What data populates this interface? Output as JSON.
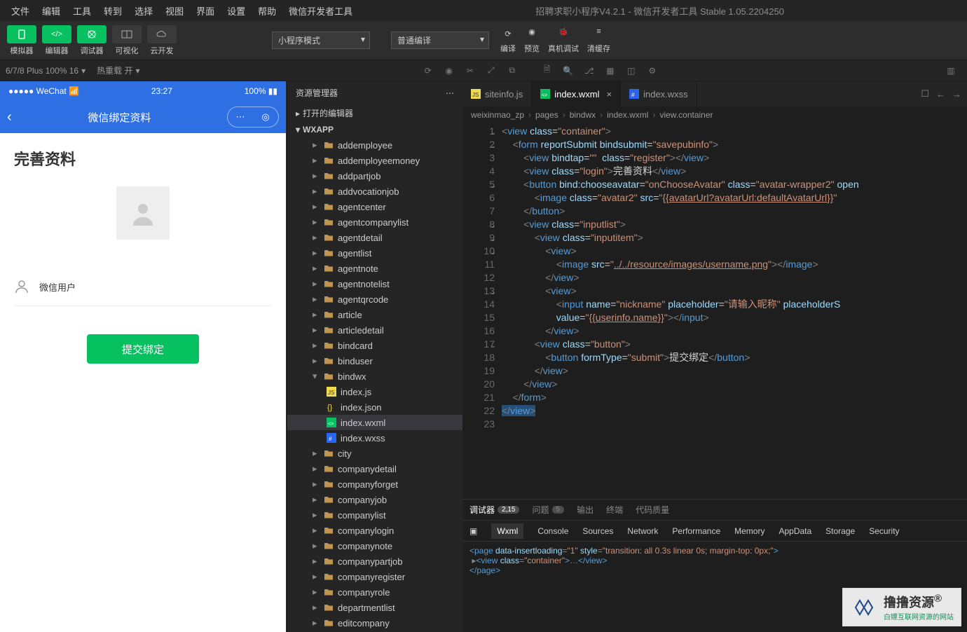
{
  "window": {
    "title": "招聘求职小程序V4.2.1 - 微信开发者工具 Stable 1.05.2204250"
  },
  "menubar": [
    "文件",
    "编辑",
    "工具",
    "转到",
    "选择",
    "视图",
    "界面",
    "设置",
    "帮助",
    "微信开发者工具"
  ],
  "toolbar": {
    "simulator": "模拟器",
    "editor": "编辑器",
    "debugger": "调试器",
    "visualize": "可视化",
    "cloud": "云开发",
    "mode_select": "小程序模式",
    "compile_select": "普通编译",
    "compile": "编译",
    "preview": "预览",
    "realdevice": "真机调试",
    "clearcache": "清缓存"
  },
  "topstrip": {
    "device": "6/7/8 Plus 100% 16",
    "hotreload": "热重载 开"
  },
  "phone": {
    "carrier": "WeChat",
    "time": "23:27",
    "battery": "100%",
    "nav_title": "微信绑定资料",
    "heading": "完善资料",
    "username": "微信用户",
    "submit": "提交绑定"
  },
  "explorer": {
    "title": "资源管理器",
    "open_editors": "打开的编辑器",
    "root": "WXAPP",
    "folders": [
      "addemployee",
      "addemployeemoney",
      "addpartjob",
      "addvocationjob",
      "agentcenter",
      "agentcompanylist",
      "agentdetail",
      "agentlist",
      "agentnote",
      "agentnotelist",
      "agentqrcode",
      "article",
      "articledetail",
      "bindcard",
      "binduser",
      "bindwx",
      "city",
      "companydetail",
      "companyforget",
      "companyjob",
      "companylist",
      "companylogin",
      "companynote",
      "companypartjob",
      "companyregister",
      "companyrole",
      "departmentlist",
      "editcompany"
    ],
    "bindwx_files": [
      "index.js",
      "index.json",
      "index.wxml",
      "index.wxss"
    ]
  },
  "tabs": [
    {
      "name": "siteinfo.js",
      "icon": "js",
      "active": false
    },
    {
      "name": "index.wxml",
      "icon": "wxml",
      "active": true
    },
    {
      "name": "index.wxss",
      "icon": "wxss",
      "active": false
    }
  ],
  "breadcrumb": [
    "weixinmao_zp",
    "pages",
    "bindwx",
    "index.wxml",
    "view.container"
  ],
  "code": {
    "lines": [
      {
        "n": 1,
        "fold": "v",
        "html": "<span class='t-brace'>&lt;</span><span class='t-tag'>view</span> <span class='t-attr'>class</span>=<span class='t-str'>\"container\"</span><span class='t-brace'>&gt;</span>"
      },
      {
        "n": 2,
        "fold": "v",
        "html": "    <span class='t-brace'>&lt;</span><span class='t-tag'>form</span> <span class='t-attr'>reportSubmit</span> <span class='t-attr'>bindsubmit</span>=<span class='t-str'>\"savepubinfo\"</span><span class='t-brace'>&gt;</span>"
      },
      {
        "n": 3,
        "html": "        <span class='t-brace'>&lt;</span><span class='t-tag'>view</span> <span class='t-attr'>bindtap</span>=<span class='t-str'>\"\"</span>  <span class='t-attr'>class</span>=<span class='t-str'>\"register\"</span><span class='t-brace'>&gt;&lt;/</span><span class='t-tag'>view</span><span class='t-brace'>&gt;</span>"
      },
      {
        "n": 4,
        "html": "        <span class='t-brace'>&lt;</span><span class='t-tag'>view</span> <span class='t-attr'>class</span>=<span class='t-str'>\"login\"</span><span class='t-brace'>&gt;</span><span class='t-txt'>完善资料</span><span class='t-brace'>&lt;/</span><span class='t-tag'>view</span><span class='t-brace'>&gt;</span>"
      },
      {
        "n": 5,
        "fold": "v",
        "html": "        <span class='t-brace'>&lt;</span><span class='t-tag'>button</span> <span class='t-attr'>bind:chooseavatar</span>=<span class='t-str'>\"onChooseAvatar\"</span> <span class='t-attr'>class</span>=<span class='t-str'>\"avatar-wrapper2\"</span> <span class='t-attr'>open</span>"
      },
      {
        "n": 6,
        "html": "            <span class='t-brace'>&lt;</span><span class='t-tag'>image</span> <span class='t-attr'>class</span>=<span class='t-str'>\"avatar2\"</span> <span class='t-attr'>src</span>=<span class='t-str'>\"<span class='t-url'>{{avatarUrl?avatarUrl:defaultAvatarUrl}}</span>\"</span>"
      },
      {
        "n": 7,
        "html": "        <span class='t-brace'>&lt;/</span><span class='t-tag'>button</span><span class='t-brace'>&gt;</span>"
      },
      {
        "n": 8,
        "fold": "v",
        "html": "        <span class='t-brace'>&lt;</span><span class='t-tag'>view</span> <span class='t-attr'>class</span>=<span class='t-str'>\"inputlist\"</span><span class='t-brace'>&gt;</span>"
      },
      {
        "n": 9,
        "fold": "v",
        "html": "            <span class='t-brace'>&lt;</span><span class='t-tag'>view</span> <span class='t-attr'>class</span>=<span class='t-str'>\"inputitem\"</span><span class='t-brace'>&gt;</span>"
      },
      {
        "n": 10,
        "fold": "v",
        "html": "                <span class='t-brace'>&lt;</span><span class='t-tag'>view</span><span class='t-brace'>&gt;</span>"
      },
      {
        "n": 11,
        "html": "                    <span class='t-brace'>&lt;</span><span class='t-tag'>image</span> <span class='t-attr'>src</span>=<span class='t-str'>\"<span class='t-url'>../../resource/images/username.png</span>\"</span><span class='t-brace'>&gt;&lt;/</span><span class='t-tag'>image</span><span class='t-brace'>&gt;</span>"
      },
      {
        "n": 12,
        "html": "                <span class='t-brace'>&lt;/</span><span class='t-tag'>view</span><span class='t-brace'>&gt;</span>"
      },
      {
        "n": 13,
        "fold": "v",
        "html": "                <span class='t-brace'>&lt;</span><span class='t-tag'>view</span><span class='t-brace'>&gt;</span>"
      },
      {
        "n": 14,
        "html": "                    <span class='t-brace'>&lt;</span><span class='t-tag'>input</span> <span class='t-attr'>name</span>=<span class='t-str'>\"nickname\"</span> <span class='t-attr'>placeholder</span>=<span class='t-str'>\"请输入昵称\"</span> <span class='t-attr'>placeholderS</span>"
      },
      {
        "n": 15,
        "html": "                    <span class='t-attr'>value</span>=<span class='t-str'>\"<span class='t-url'>{{userinfo.name}}</span>\"</span><span class='t-brace'>&gt;&lt;/</span><span class='t-tag'>input</span><span class='t-brace'>&gt;</span>"
      },
      {
        "n": 16,
        "html": "                <span class='t-brace'>&lt;/</span><span class='t-tag'>view</span><span class='t-brace'>&gt;</span>"
      },
      {
        "n": 17,
        "fold": "v",
        "html": "            <span class='t-brace'>&lt;</span><span class='t-tag'>view</span> <span class='t-attr'>class</span>=<span class='t-str'>\"button\"</span><span class='t-brace'>&gt;</span>"
      },
      {
        "n": 18,
        "html": "                <span class='t-brace'>&lt;</span><span class='t-tag'>button</span> <span class='t-attr'>formType</span>=<span class='t-str'>\"submit\"</span><span class='t-brace'>&gt;</span><span class='t-txt'>提交绑定</span><span class='t-brace'>&lt;/</span><span class='t-tag'>button</span><span class='t-brace'>&gt;</span>"
      },
      {
        "n": 19,
        "html": "            <span class='t-brace'>&lt;/</span><span class='t-tag'>view</span><span class='t-brace'>&gt;</span>"
      },
      {
        "n": 20,
        "html": "        <span class='t-brace'>&lt;/</span><span class='t-tag'>view</span><span class='t-brace'>&gt;</span>"
      },
      {
        "n": 21,
        "html": "    <span class='t-brace'>&lt;/</span><span class='t-tag'>form</span><span class='t-brace'>&gt;</span>"
      },
      {
        "n": 22,
        "html": "<span class='hl'><span class='t-brace'>&lt;/</span><span class='t-tag'>view</span><span class='t-brace'>&gt;</span></span>"
      },
      {
        "n": 23,
        "html": ""
      }
    ]
  },
  "panel": {
    "tabs": [
      {
        "label": "调试器",
        "badge": "2,15",
        "active": true
      },
      {
        "label": "问题",
        "badge": "5"
      },
      {
        "label": "输出"
      },
      {
        "label": "终端"
      },
      {
        "label": "代码质量"
      }
    ],
    "devtools": [
      "Wxml",
      "Console",
      "Sources",
      "Network",
      "Performance",
      "Memory",
      "AppData",
      "Storage",
      "Security"
    ],
    "dom": "<page data-insertloading=\"1\" style=\"transition: all 0.3s linear 0s; margin-top: 0px;\">\n ▸<view class=\"container\">…</view>\n</page>"
  },
  "watermark": {
    "brand": "撸撸资源",
    "tag": "®",
    "sub": "白嫖互联网资源的网站"
  }
}
